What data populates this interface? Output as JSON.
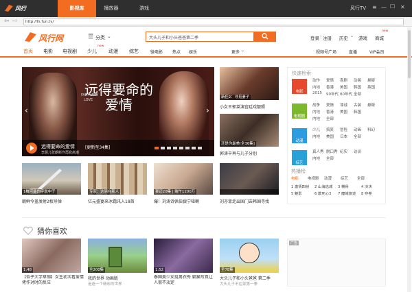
{
  "window": {
    "app_name": "风行",
    "tabs": [
      "影视库",
      "播放器",
      "游戏"
    ],
    "right_title": "风行TV",
    "controls": [
      "≡",
      "—",
      "☐",
      "✕"
    ]
  },
  "address": {
    "url": "http://fs.fun.tv/"
  },
  "header": {
    "logo": "风行网",
    "menu_label": "分类",
    "search_placeholder": "大头儿子和小头爸爸第二季",
    "links": [
      "登录",
      "注册",
      "历史",
      "游戏",
      "商城"
    ],
    "badge": "new"
  },
  "nav": {
    "left": [
      "首页",
      "电影",
      "电视剧",
      "少儿",
      "动漫",
      "综艺",
      "微电影",
      "热点",
      "娱乐"
    ],
    "more": "更多",
    "right": [
      "视频号广场",
      "直播",
      "VIP会员"
    ]
  },
  "banner": {
    "title": "远得要命的爱情",
    "sub1": "FAR AWAY",
    "sub2": "LOVE",
    "caption": "远得要命的爱情",
    "episodes": "[更新至34集]",
    "desc": "李晨儿张朗新作再掀高潮",
    "dots": 8,
    "colors": {
      "bg": "#2a0f0c",
      "accent": "#b71e1e"
    }
  },
  "side_thumbs": [
    {
      "cap": "新任2：寻觅妻子",
      "title": "小女王郭莱演宫廷戏靓照"
    },
    {
      "cap": "还是你最美[全36集]",
      "title": "郭涛辛再与儿子分别"
    },
    {
      "cap": "",
      "title": "刘亦菲走出国门去韩国寻找"
    }
  ],
  "row1": [
    {
      "cap": "1枚可能的宇航中子",
      "title": "朝鲜今盖发射2枚导弹"
    },
    {
      "cap": "专家：这届在新人",
      "title": "亿元盛宴来冰霜讯入18首"
    },
    {
      "cap": "豪迈20集 | 端午1200万",
      "title": "爆！刘涛诗佩伯银宁哑喇"
    },
    {
      "cap": "",
      "title": ""
    }
  ],
  "quick": {
    "title": "快速检索",
    "groups": [
      {
        "label": "电影",
        "rows": [
          [
            "动作",
            "爱情",
            "喜剧",
            "动画",
            "悬疑"
          ],
          [
            "内地",
            "香港",
            "美国",
            "韩国",
            "英国"
          ],
          [
            "2015",
            "90年代",
            "80年代",
            "全部"
          ]
        ]
      },
      {
        "label": "电视剧",
        "rows": [
          [
            "战争",
            "爱情",
            "谍战",
            "古装",
            "悬疑"
          ],
          [
            "内地",
            "香港",
            "美国",
            "韩国"
          ],
          [
            "内地",
            "全部"
          ]
        ]
      },
      {
        "label": "动漫",
        "rows": [
          [
            "少儿",
            "搞笑",
            "冒险",
            "动画",
            "科幻"
          ],
          [
            "内地",
            "美国",
            "日本",
            "全部"
          ]
        ]
      },
      {
        "label": "综艺",
        "rows": [
          [
            "真人秀",
            "脱口秀",
            "纪实",
            "访谈"
          ],
          [
            "内地",
            "全部"
          ]
        ]
      }
    ]
  },
  "hot": {
    "title": "热播榜",
    "tabs": [
      "电影",
      "电视剧",
      "动漫",
      "综艺",
      "全部"
    ],
    "items": [
      [
        "1 激情四射",
        "2 山海逃城",
        "3 横骨",
        "4 决决"
      ],
      [
        "5 魅影",
        "6 欺死心3",
        "7 魔域旅途",
        "8 夺卷"
      ]
    ]
  },
  "guess": {
    "title": "猜你喜欢",
    "items": [
      {
        "cap": "1:48",
        "title": "【怡子大学草咖】女生初次看爱情佬作对时的反应",
        "sub": ""
      },
      {
        "cap": "全200集",
        "title": "我的世界 动画版",
        "sub": "追逐一个精彩的世界"
      },
      {
        "cap": "1:52",
        "title": "泰国美少女挺男衣秀 躺猫写真让人很不淡定",
        "sub": ""
      },
      {
        "cap": "全78集",
        "title": "大头儿子和小头爸爸 第二季",
        "sub": "大头儿子不在家第一季"
      }
    ],
    "ad": "广告"
  }
}
